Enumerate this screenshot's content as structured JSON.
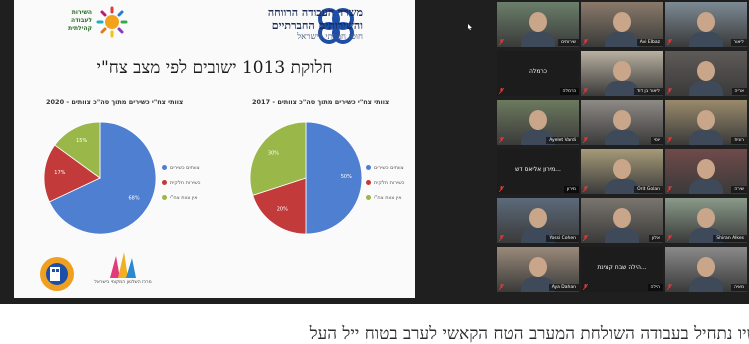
{
  "slide": {
    "ministry_line1": "משרד העבודה הרווחה",
    "ministry_line2": "והשירותים החברתיים",
    "ministry_line3": "חוסן חברתי לישראל",
    "gov_logo_text": "השירות לעבודה קהילתית",
    "title": "חלוקת 1013 ישובים לפי מצב צח\"י",
    "bottom_logo_text": "מרכז השלטון המקומי בישראל",
    "colors": {
      "blue": "#4f7fd0",
      "red": "#c33a3a",
      "green": "#9ab84a",
      "title": "#1a2a55"
    }
  },
  "chart_data": [
    {
      "type": "pie",
      "title": "צוותי צח\"י כשירים מתוך סה\"כ צוותים - 2020",
      "categories": [
        "צוותים כשירים",
        "כשירות חלקית",
        "אין צוות צח\"י"
      ],
      "values": [
        68,
        17,
        15
      ],
      "labels": [
        "68%",
        "17%",
        "15%"
      ],
      "colors": [
        "#4f7fd0",
        "#c33a3a",
        "#9ab84a"
      ],
      "legend": "right"
    },
    {
      "type": "pie",
      "title": "צוותי צח\"י כשירים מתוך סה\"כ צוותים - 2017",
      "categories": [
        "צוותים כשירים",
        "כשירות חלקית",
        "אין צוות צח\"י"
      ],
      "values": [
        50,
        20,
        30
      ],
      "labels": [
        "50%",
        "20%",
        "30%"
      ],
      "colors": [
        "#4f7fd0",
        "#c33a3a",
        "#9ab84a"
      ],
      "legend": "right"
    }
  ],
  "participants": [
    {
      "name": "שירותים",
      "video": true,
      "scene": "#6b7f6b"
    },
    {
      "name": "Avi Elbaz",
      "video": true,
      "scene": "#8a7a6a"
    },
    {
      "name": "ליאור",
      "video": true,
      "scene": "#7d8a94"
    },
    {
      "name": "כרמלה",
      "video": false,
      "center": "כרמלה"
    },
    {
      "name": "ליאור בן דוד",
      "video": true,
      "scene": "#b8b0a0"
    },
    {
      "name": "אריה",
      "video": true,
      "scene": "#5e5a58"
    },
    {
      "name": "Ayelet Vardi",
      "video": true,
      "scene": "#6c7a5e"
    },
    {
      "name": "יוסי",
      "video": true,
      "scene": "#8e8a86"
    },
    {
      "name": "רונית",
      "video": true,
      "scene": "#9a8a6c"
    },
    {
      "name": "מירון",
      "video": false,
      "center": "...מירון אליאס דש"
    },
    {
      "name": "Orit Golan",
      "video": true,
      "scene": "#a69a78",
      "active": true
    },
    {
      "name": "שירה",
      "video": true,
      "scene": "#704a4a"
    },
    {
      "name": "Yossi Cohen",
      "video": true,
      "scene": "#5c6a7a"
    },
    {
      "name": "אלון",
      "video": true,
      "scene": "#7a756e"
    },
    {
      "name": "Shiran Alkes",
      "video": true,
      "scene": "#8a9a8a"
    },
    {
      "name": "Aya Dahan",
      "video": true,
      "scene": "#9a8a7a"
    },
    {
      "name": "הילה",
      "video": false,
      "center": "...הילה שבח קצינת"
    },
    {
      "name": "מאיה",
      "video": true,
      "scene": "#8a8a8a"
    }
  ],
  "caption": "כשיו נתחיל בעבודה השולחת המערב הטח הקאשי לערב בטוח ייל העל"
}
